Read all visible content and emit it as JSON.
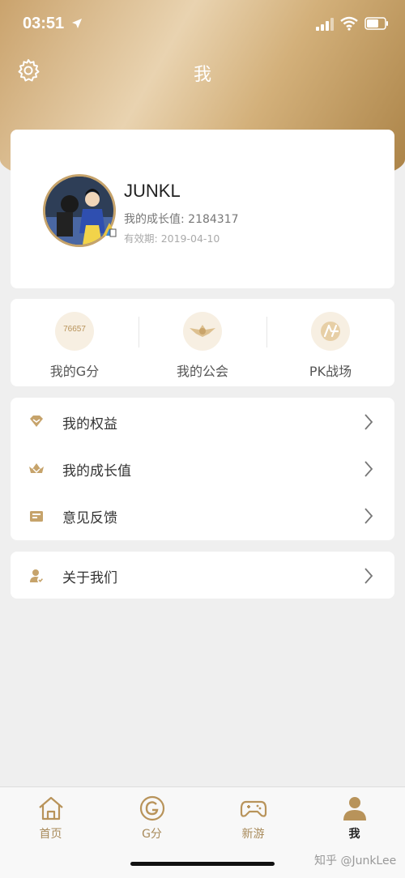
{
  "status_bar": {
    "time": "03:51"
  },
  "header": {
    "title": "我"
  },
  "profile": {
    "username": "JUNKL",
    "growth_label": "我的成长值:",
    "growth_value": "2184317",
    "valid_label": "有效期:",
    "valid_value": "2019-04-10"
  },
  "stats": [
    {
      "label": "我的G分",
      "badge": "76657",
      "icon": "g-points-icon"
    },
    {
      "label": "我的公会",
      "icon": "guild-emblem-icon"
    },
    {
      "label": "PK战场",
      "icon": "pk-battle-icon"
    }
  ],
  "menu": [
    {
      "label": "我的权益",
      "icon": "gem-icon"
    },
    {
      "label": "我的成长值",
      "icon": "growth-crown-icon"
    },
    {
      "label": "意见反馈",
      "icon": "feedback-envelope-icon"
    }
  ],
  "about": {
    "label": "关于我们",
    "icon": "user-check-icon"
  },
  "tabs": [
    {
      "label": "首页",
      "icon": "home-icon"
    },
    {
      "label": "G分",
      "icon": "g-coin-icon"
    },
    {
      "label": "新游",
      "icon": "gamepad-icon"
    },
    {
      "label": "我",
      "icon": "person-icon",
      "active": true
    }
  ],
  "watermark": "知乎 @JunkLee",
  "colors": {
    "accent": "#c6a36b",
    "background": "#efefef"
  }
}
